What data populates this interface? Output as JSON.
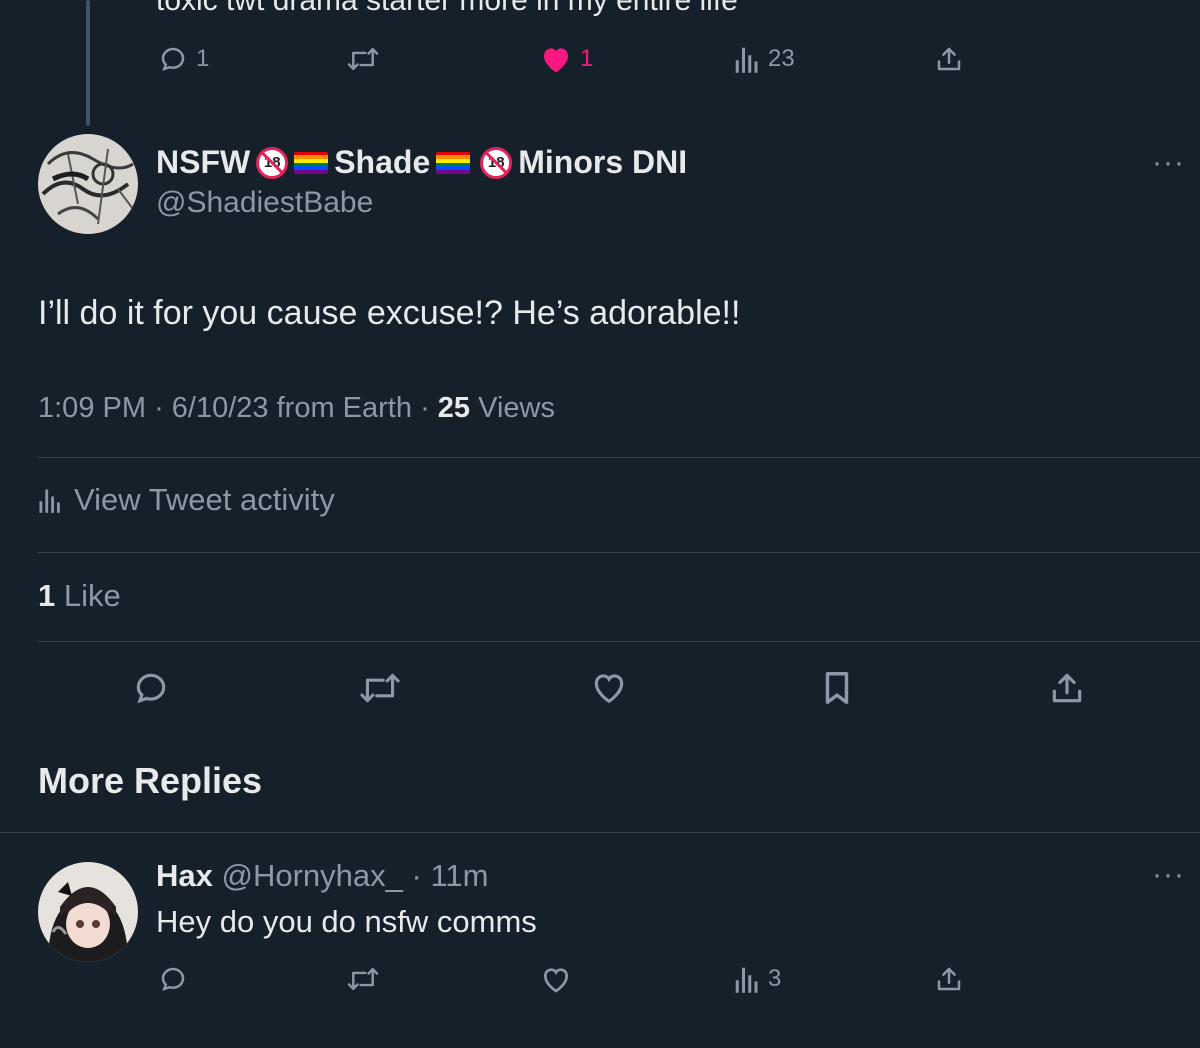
{
  "previous_tweet": {
    "text": "toxic twt drama starter more in my entire life",
    "reply_count": "1",
    "like_count": "1",
    "view_count": "23"
  },
  "main_tweet": {
    "name_parts": [
      "NSFW",
      "Shade",
      "Minors DNI"
    ],
    "handle": "@ShadiestBabe",
    "more_glyph": "···",
    "text": "I’ll do it for you cause excuse!? He’s adorable!!",
    "time": "1:09 PM",
    "date": "6/10/23",
    "source": "from Earth",
    "views_count": "25",
    "views_label": "Views",
    "meta_sep": "·",
    "activity_label": "View Tweet activity",
    "likes_count": "1",
    "likes_label": "Like"
  },
  "more_replies": {
    "title": "More Replies"
  },
  "reply": {
    "name": "Hax",
    "handle": "@Hornyhax_",
    "sep": "·",
    "time": "11m",
    "text": "Hey do you do nsfw comms",
    "view_count": "3",
    "more_glyph": "···"
  },
  "icons": [
    "reply-icon",
    "retweet-icon",
    "heart-icon",
    "heart-filled-icon",
    "views-icon",
    "share-icon",
    "bookmark-icon",
    "more-icon",
    "adult-content-icon",
    "rainbow-flag-icon"
  ],
  "colors": {
    "background": "#15202b",
    "text": "#e7e9ea",
    "muted": "#8b98a5",
    "like": "#f91880",
    "divider": "#38444d"
  }
}
